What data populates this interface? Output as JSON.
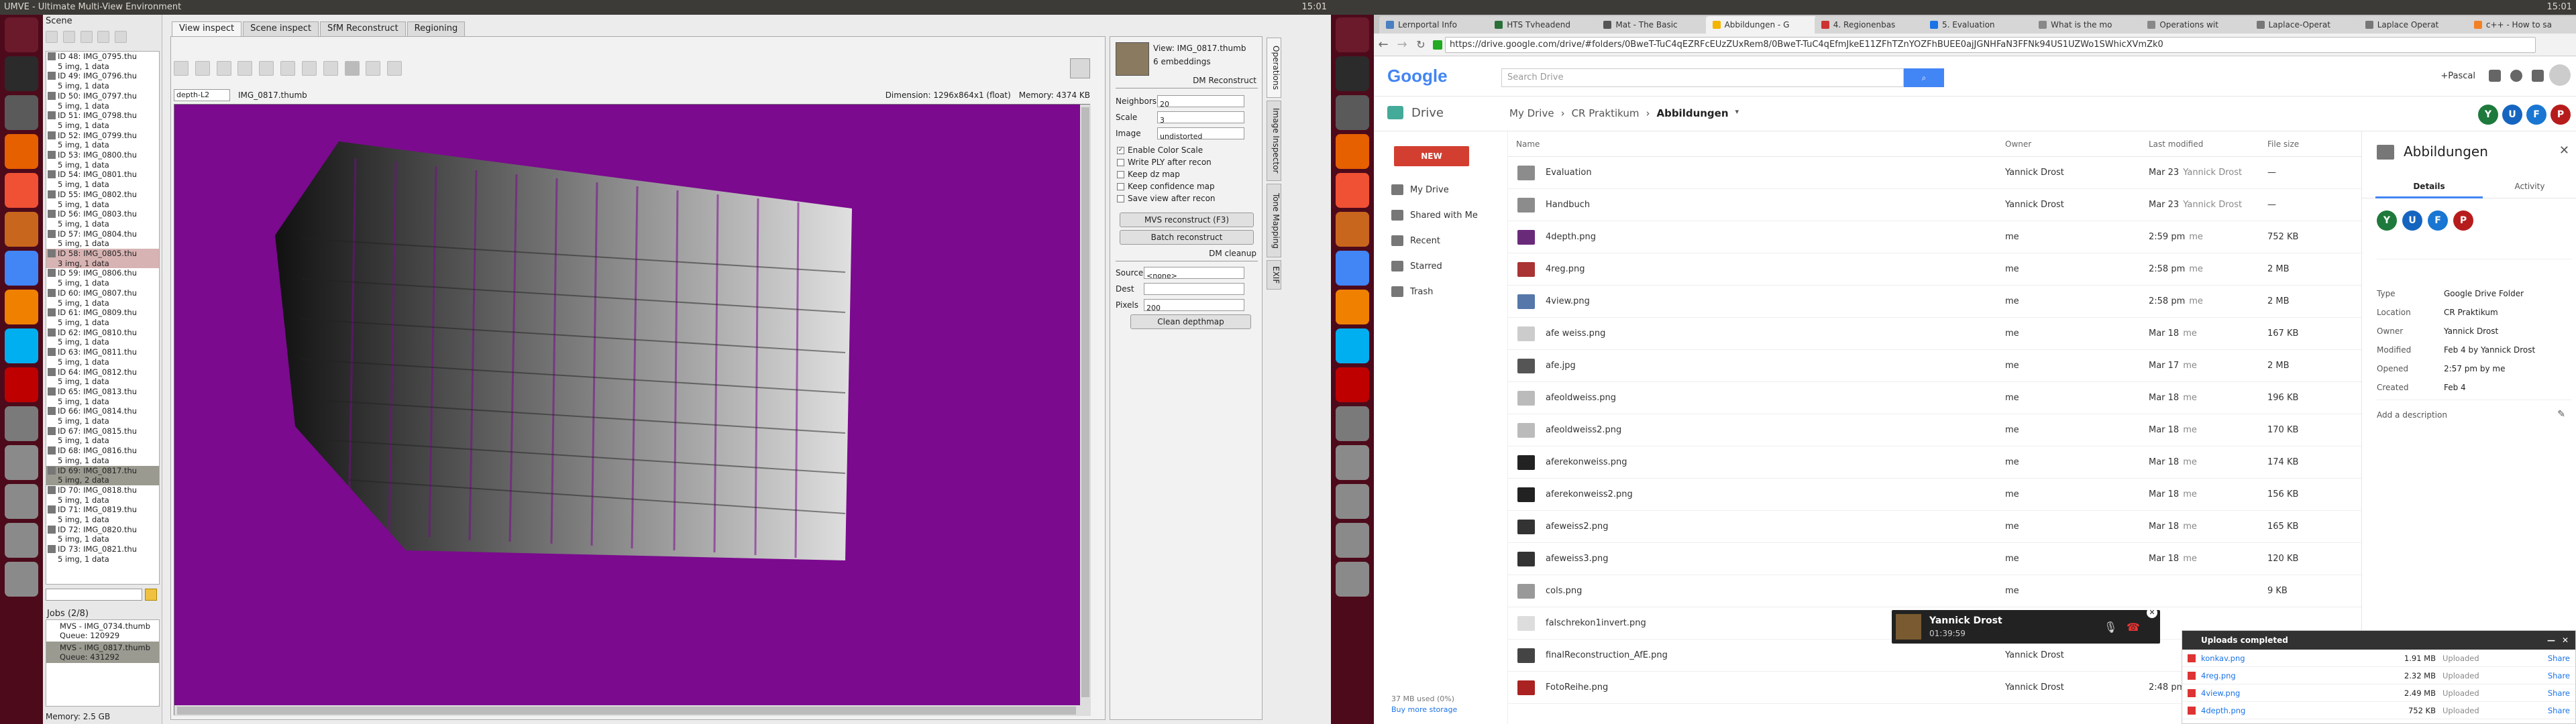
{
  "left_topbar": {
    "title": "UMVE - Ultimate Multi-View Environment",
    "time": "15:01"
  },
  "right_topbar": {
    "time": "15:01"
  },
  "left_launcher": {
    "icons": [
      "dash-icon",
      "terminal-icon",
      "files-icon",
      "firefox-icon",
      "git-icon",
      "settings-icon",
      "chrome-icon",
      "vlc-icon",
      "skype-icon",
      "filezilla-icon",
      "editor-icon",
      "drive-icon",
      "drive-icon",
      "drive-icon",
      "drive-icon"
    ]
  },
  "right_launcher": {
    "icons": [
      "dash-icon",
      "terminal-icon",
      "files-icon",
      "firefox-icon",
      "git-icon",
      "settings-icon",
      "chrome-icon",
      "vlc-icon",
      "skype-icon",
      "filezilla-icon",
      "editor-icon",
      "drive-icon",
      "drive-icon",
      "drive-icon",
      "drive-icon"
    ]
  },
  "mve": {
    "scene_title": "Scene",
    "scene_items": [
      {
        "id": "ID 48: IMG_0795.thu",
        "sub": "5 img, 1 data"
      },
      {
        "id": "ID 49: IMG_0796.thu",
        "sub": "5 img, 1 data"
      },
      {
        "id": "ID 50: IMG_0797.thu",
        "sub": "5 img, 1 data"
      },
      {
        "id": "ID 51: IMG_0798.thu",
        "sub": "5 img, 1 data"
      },
      {
        "id": "ID 52: IMG_0799.thu",
        "sub": "5 img, 1 data"
      },
      {
        "id": "ID 53: IMG_0800.thu",
        "sub": "5 img, 1 data"
      },
      {
        "id": "ID 54: IMG_0801.thu",
        "sub": "5 img, 1 data"
      },
      {
        "id": "ID 55: IMG_0802.thu",
        "sub": "5 img, 1 data"
      },
      {
        "id": "ID 56: IMG_0803.thu",
        "sub": "5 img, 1 data"
      },
      {
        "id": "ID 57: IMG_0804.thu",
        "sub": "5 img, 1 data"
      },
      {
        "id": "ID 58: IMG_0805.thu",
        "sub": "3 img, 1 data"
      },
      {
        "id": "ID 59: IMG_0806.thu",
        "sub": "5 img, 1 data"
      },
      {
        "id": "ID 60: IMG_0807.thu",
        "sub": "5 img, 1 data"
      },
      {
        "id": "ID 61: IMG_0809.thu",
        "sub": "5 img, 1 data"
      },
      {
        "id": "ID 62: IMG_0810.thu",
        "sub": "5 img, 1 data"
      },
      {
        "id": "ID 63: IMG_0811.thu",
        "sub": "5 img, 1 data"
      },
      {
        "id": "ID 64: IMG_0812.thu",
        "sub": "5 img, 1 data"
      },
      {
        "id": "ID 65: IMG_0813.thu",
        "sub": "5 img, 1 data"
      },
      {
        "id": "ID 66: IMG_0814.thu",
        "sub": "5 img, 1 data"
      },
      {
        "id": "ID 67: IMG_0815.thu",
        "sub": "5 img, 1 data"
      },
      {
        "id": "ID 68: IMG_0816.thu",
        "sub": "5 img, 1 data"
      },
      {
        "id": "ID 69: IMG_0817.thu",
        "sub": "5 img, 2 data"
      },
      {
        "id": "ID 70: IMG_0818.thu",
        "sub": "5 img, 1 data"
      },
      {
        "id": "ID 71: IMG_0819.thu",
        "sub": "5 img, 1 data"
      },
      {
        "id": "ID 72: IMG_0820.thu",
        "sub": "5 img, 1 data"
      },
      {
        "id": "ID 73: IMG_0821.thu",
        "sub": "5 img, 1 data"
      }
    ],
    "jobs_title": "Jobs (2/8)",
    "jobs": [
      {
        "title": "MVS - IMG_0734.thumb",
        "queue": "Queue: 120929"
      },
      {
        "title": "MVS - IMG_0817.thumb",
        "queue": "Queue: 431292"
      }
    ],
    "memory": "Memory: 2.5 GB",
    "tabs": [
      "View inspect",
      "Scene inspect",
      "SfM Reconstruct",
      "Regioning"
    ],
    "depth_select": "depth-L2",
    "image_name": "IMG_0817.thumb",
    "dimension": "Dimension: 1296x864x1 (float)",
    "memory_top": "Memory: 4374 KB",
    "right_panel": {
      "view_title": "View: IMG_0817.thumb",
      "embeddings": "6 embeddings",
      "section": "DM Reconstruct",
      "neighbors_label": "Neighbors",
      "neighbors": "20",
      "scale_label": "Scale",
      "scale": "3",
      "image_label": "Image",
      "image": "undistorted",
      "checks": [
        {
          "label": "Enable Color Scale",
          "on": "✓"
        },
        {
          "label": "Write PLY after recon",
          "on": ""
        },
        {
          "label": "Keep dz map",
          "on": ""
        },
        {
          "label": "Keep confidence map",
          "on": ""
        },
        {
          "label": "Save view after recon",
          "on": ""
        }
      ],
      "mvs_button": "MVS reconstruct (F3)",
      "batch_button": "Batch reconstruct",
      "cleanup_section": "DM cleanup",
      "source_label": "Source",
      "source": "<none>",
      "dest_label": "Dest",
      "dest": "",
      "pixels_label": "Pixels",
      "pixels": "200",
      "clean_button": "Clean depthmap",
      "vtabs": [
        "Operations",
        "Image Inspector",
        "Tone Mapping",
        "EXIF"
      ]
    }
  },
  "chrome": {
    "tabs": [
      {
        "label": "Lernportal Info",
        "color": "#4a7fc1"
      },
      {
        "label": "HTS Tvheadend",
        "color": "#2a6f3a"
      },
      {
        "label": "Mat - The Basic",
        "color": "#555"
      },
      {
        "label": "Abbildungen - G",
        "color": "#f4b400"
      },
      {
        "label": "4. Regionenbas",
        "color": "#c33"
      },
      {
        "label": "5. Evaluation",
        "color": "#1a73e8"
      },
      {
        "label": "What is the mo",
        "color": "#888"
      },
      {
        "label": "Operations wit",
        "color": "#888"
      },
      {
        "label": "Laplace-Operat",
        "color": "#777"
      },
      {
        "label": "Laplace Operat",
        "color": "#777"
      },
      {
        "label": "c++ - How to sa",
        "color": "#f48024"
      }
    ],
    "url": "https://drive.google.com/drive/#folders/0BweT-TuC4qEZRFcEUzZUxRem8/0BweT-TuC4qEfmJkeE11ZFhTZnYOZFhBUEE0ajJGNHFaN3FFNk94US1UZWo1SWhicXVmZk0",
    "search_placeholder": "Search Drive",
    "user": "+Pascal",
    "logo": "Google",
    "drive_label": "Drive",
    "breadcrumb": [
      "My Drive",
      "CR Praktikum",
      "Abbildungen"
    ],
    "new_button": "NEW",
    "nav": [
      "My Drive",
      "Shared with Me",
      "Recent",
      "Starred",
      "Trash"
    ],
    "storage": "37 MB used (0%)",
    "buy_storage": "Buy more storage",
    "columns": {
      "name": "Name",
      "owner": "Owner",
      "modified": "Last modified",
      "size": "File size"
    },
    "files": [
      {
        "name": "Evaluation",
        "owner": "Yannick Drost",
        "modified": "Mar 23",
        "by": "Yannick Drost",
        "size": "—",
        "color": "#8c8c8c"
      },
      {
        "name": "Handbuch",
        "owner": "Yannick Drost",
        "modified": "Mar 23",
        "by": "Yannick Drost",
        "size": "—",
        "color": "#8c8c8c"
      },
      {
        "name": "4depth.png",
        "owner": "me",
        "modified": "2:59 pm",
        "by": "me",
        "size": "752 KB",
        "color": "#6a2a7a"
      },
      {
        "name": "4reg.png",
        "owner": "me",
        "modified": "2:58 pm",
        "by": "me",
        "size": "2 MB",
        "color": "#a33"
      },
      {
        "name": "4view.png",
        "owner": "me",
        "modified": "2:58 pm",
        "by": "me",
        "size": "2 MB",
        "color": "#57a"
      },
      {
        "name": "afe weiss.png",
        "owner": "me",
        "modified": "Mar 18",
        "by": "me",
        "size": "167 KB",
        "color": "#ccc"
      },
      {
        "name": "afe.jpg",
        "owner": "me",
        "modified": "Mar 17",
        "by": "me",
        "size": "2 MB",
        "color": "#555"
      },
      {
        "name": "afeoldweiss.png",
        "owner": "me",
        "modified": "Mar 18",
        "by": "me",
        "size": "196 KB",
        "color": "#bbb"
      },
      {
        "name": "afeoldweiss2.png",
        "owner": "me",
        "modified": "Mar 18",
        "by": "me",
        "size": "170 KB",
        "color": "#bbb"
      },
      {
        "name": "aferekonweiss.png",
        "owner": "me",
        "modified": "Mar 18",
        "by": "me",
        "size": "174 KB",
        "color": "#222"
      },
      {
        "name": "aferekonweiss2.png",
        "owner": "me",
        "modified": "Mar 18",
        "by": "me",
        "size": "156 KB",
        "color": "#222"
      },
      {
        "name": "afeweiss2.png",
        "owner": "me",
        "modified": "Mar 18",
        "by": "me",
        "size": "165 KB",
        "color": "#333"
      },
      {
        "name": "afeweiss3.png",
        "owner": "me",
        "modified": "Mar 18",
        "by": "me",
        "size": "120 KB",
        "color": "#333"
      },
      {
        "name": "cols.png",
        "owner": "me",
        "modified": "",
        "by": "",
        "size": "9 KB",
        "color": "#999"
      },
      {
        "name": "falschrekon1invert.png",
        "owner": "",
        "modified": "",
        "by": "",
        "size": "",
        "color": "#ddd"
      },
      {
        "name": "finalReconstruction_AfE.png",
        "owner": "Yannick Drost",
        "modified": "",
        "by": "",
        "size": "",
        "color": "#444"
      },
      {
        "name": "FotoReihe.png",
        "owner": "Yannick Drost",
        "modified": "2:48 pm",
        "by": "Yannick Drost",
        "size": "",
        "color": "#a22"
      }
    ],
    "details": {
      "title": "Abbildungen",
      "tab_details": "Details",
      "tab_activity": "Activity",
      "rows": [
        {
          "k": "Type",
          "v": "Google Drive Folder"
        },
        {
          "k": "Location",
          "v": "CR Praktikum"
        },
        {
          "k": "Owner",
          "v": "Yannick Drost"
        },
        {
          "k": "Modified",
          "v": "Feb 4 by Yannick Drost"
        },
        {
          "k": "Opened",
          "v": "2:57 pm by me"
        },
        {
          "k": "Created",
          "v": "Feb 4"
        }
      ],
      "add_description": "Add a description"
    },
    "avatars": [
      {
        "letter": "Y",
        "color": "#1e7a3c"
      },
      {
        "letter": "U",
        "color": "#1565c0"
      },
      {
        "letter": "F",
        "color": "#1976d2"
      },
      {
        "letter": "P",
        "color": "#b71c1c"
      }
    ],
    "call": {
      "name": "Yannick Drost",
      "time": "01:39:59"
    },
    "uploads": {
      "title": "Uploads completed",
      "items": [
        {
          "name": "konkav.png",
          "size": "1.91 MB",
          "status": "Uploaded",
          "action": "Share"
        },
        {
          "name": "4reg.png",
          "size": "2.32 MB",
          "status": "Uploaded",
          "action": "Share"
        },
        {
          "name": "4view.png",
          "size": "2.49 MB",
          "status": "Uploaded",
          "action": "Share"
        },
        {
          "name": "4depth.png",
          "size": "752 KB",
          "status": "Uploaded",
          "action": "Share"
        }
      ]
    }
  }
}
